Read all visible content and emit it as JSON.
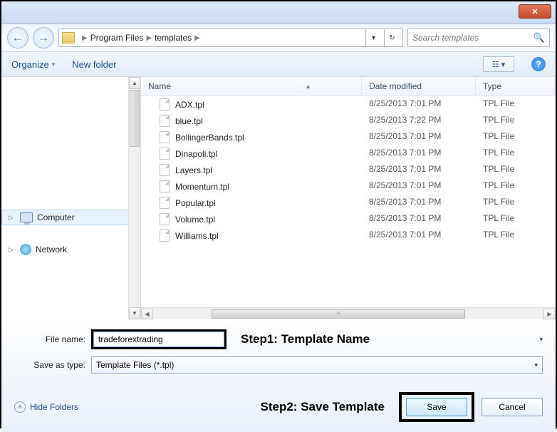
{
  "titlebar": {
    "close_glyph": "✕"
  },
  "nav": {
    "back_glyph": "←",
    "forward_glyph": "→",
    "breadcrumb": [
      "Program Files",
      "templates"
    ],
    "crumb_sep": "▶",
    "dropdown_glyph": "▾",
    "refresh_glyph": "↻"
  },
  "search": {
    "placeholder": "Search templates",
    "icon": "🔍"
  },
  "toolbar": {
    "organize": "Organize",
    "organize_arrow": "▾",
    "new_folder": "New folder",
    "view_glyph": "☷ ▾",
    "help_glyph": "?"
  },
  "sidebar": {
    "items": [
      {
        "expand": "▷",
        "label": "Computer",
        "selected": true
      },
      {
        "expand": "▷",
        "label": "Network",
        "selected": false
      }
    ]
  },
  "columns": {
    "name": "Name",
    "date": "Date modified",
    "type": "Type",
    "sort_glyph": "▲"
  },
  "files": [
    {
      "name": "ADX.tpl",
      "date": "8/25/2013 7:01 PM",
      "type": "TPL File"
    },
    {
      "name": "blue.tpl",
      "date": "8/25/2013 7:22 PM",
      "type": "TPL File"
    },
    {
      "name": "BollingerBands.tpl",
      "date": "8/25/2013 7:01 PM",
      "type": "TPL File"
    },
    {
      "name": "Dinapoli.tpl",
      "date": "8/25/2013 7:01 PM",
      "type": "TPL File"
    },
    {
      "name": "Layers.tpl",
      "date": "8/25/2013 7:01 PM",
      "type": "TPL File"
    },
    {
      "name": "Momentum.tpl",
      "date": "8/25/2013 7:01 PM",
      "type": "TPL File"
    },
    {
      "name": "Popular.tpl",
      "date": "8/25/2013 7:01 PM",
      "type": "TPL File"
    },
    {
      "name": "Volume.tpl",
      "date": "8/25/2013 7:01 PM",
      "type": "TPL File"
    },
    {
      "name": "Williams.tpl",
      "date": "8/25/2013 7:01 PM",
      "type": "TPL File"
    }
  ],
  "form": {
    "file_name_label": "File name:",
    "file_name_value": "tradeforextrading",
    "save_type_label": "Save as type:",
    "save_type_value": "Template Files (*.tpl)",
    "combo_arrow": "▾"
  },
  "annotations": {
    "step1": "Step1: Template Name",
    "step2": "Step2: Save Template"
  },
  "footer": {
    "hide_folders": "Hide Folders",
    "chevron": "˄",
    "save": "Save",
    "cancel": "Cancel"
  },
  "scroll": {
    "up": "▲",
    "down": "▼",
    "left": "◀",
    "right": "▶",
    "grip": "≡"
  }
}
